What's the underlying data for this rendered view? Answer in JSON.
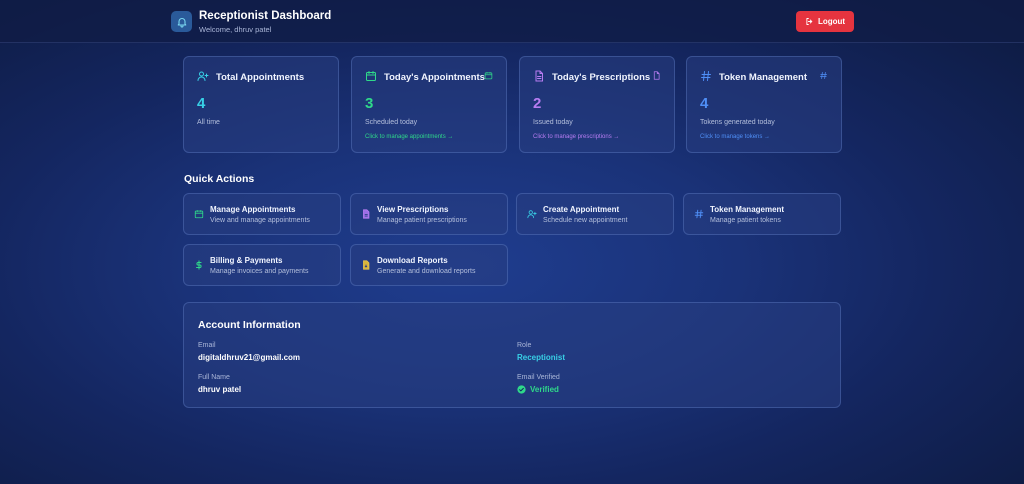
{
  "header": {
    "title": "Receptionist Dashboard",
    "subtitle": "Welcome, dhruv patel",
    "logout_label": "Logout",
    "brand_icon": "bell-icon"
  },
  "stats": [
    {
      "title": "Total Appointments",
      "value": "4",
      "sub": "All time",
      "link": "",
      "icon": "user-plus-icon",
      "color": "#38d0e6"
    },
    {
      "title": "Today's Appointments",
      "value": "3",
      "sub": "Scheduled today",
      "link": "Click to manage appointments →",
      "icon": "calendar-icon",
      "color": "#2fd98a"
    },
    {
      "title": "Today's Prescriptions",
      "value": "2",
      "sub": "Issued today",
      "link": "Click to manage prescriptions →",
      "icon": "document-icon",
      "color": "#b77cf2"
    },
    {
      "title": "Token Management",
      "value": "4",
      "sub": "Tokens generated today",
      "link": "Click to manage tokens →",
      "icon": "hash-icon",
      "color": "#4f8ff7"
    }
  ],
  "quick_actions": {
    "title": "Quick Actions",
    "items": [
      {
        "title": "Manage Appointments",
        "sub": "View and manage appointments",
        "icon": "calendar-icon"
      },
      {
        "title": "View Prescriptions",
        "sub": "Manage patient prescriptions",
        "icon": "document-icon"
      },
      {
        "title": "Create Appointment",
        "sub": "Schedule new appointment",
        "icon": "user-plus-icon"
      },
      {
        "title": "Token Management",
        "sub": "Manage patient tokens",
        "icon": "hash-icon"
      },
      {
        "title": "Billing & Payments",
        "sub": "Manage invoices and payments",
        "icon": "dollar-icon"
      },
      {
        "title": "Download Reports",
        "sub": "Generate and download reports",
        "icon": "report-icon"
      }
    ]
  },
  "account": {
    "title": "Account Information",
    "email_label": "Email",
    "email": "digitaldhruv21@gmail.com",
    "role_label": "Role",
    "role": "Receptionist",
    "name_label": "Full Name",
    "name": "dhruv patel",
    "verified_label": "Email Verified",
    "verified": "Verified"
  }
}
